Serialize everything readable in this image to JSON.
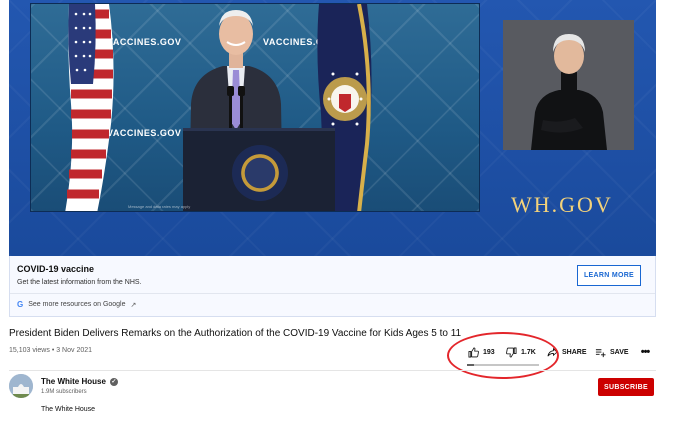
{
  "player": {
    "backdrop_texts": [
      "VACCINES.GOV",
      "VACCINES.GOV",
      "VACCINES.GOV"
    ],
    "footnote": "Message and data rates may apply",
    "brand": "WH.GOV",
    "brand_color": "#f3d27a",
    "background_color": "#1d4fa3"
  },
  "info_card": {
    "title": "COVID-19 vaccine",
    "description": "Get the latest information from the NHS.",
    "button": "LEARN MORE",
    "more_link": "See more resources on Google",
    "google_icon": "G",
    "accent_color": "#1967d2"
  },
  "video": {
    "title": "President Biden Delivers Remarks on the Authorization of the COVID-19 Vaccine for Kids Ages 5 to 11",
    "views": "15,103 views",
    "separator": "•",
    "date": "3 Nov 2021"
  },
  "actions": {
    "likes": "193",
    "dislikes": "1.7K",
    "share": "SHARE",
    "save": "SAVE",
    "more": "•••",
    "like_ratio": 0.1,
    "annotation_color": "#e3262b"
  },
  "channel": {
    "name": "The White House",
    "subscribers": "1.9M subscribers",
    "description": "The White House",
    "subscribe": "SUBSCRIBE",
    "subscribe_color": "#cc0000"
  }
}
